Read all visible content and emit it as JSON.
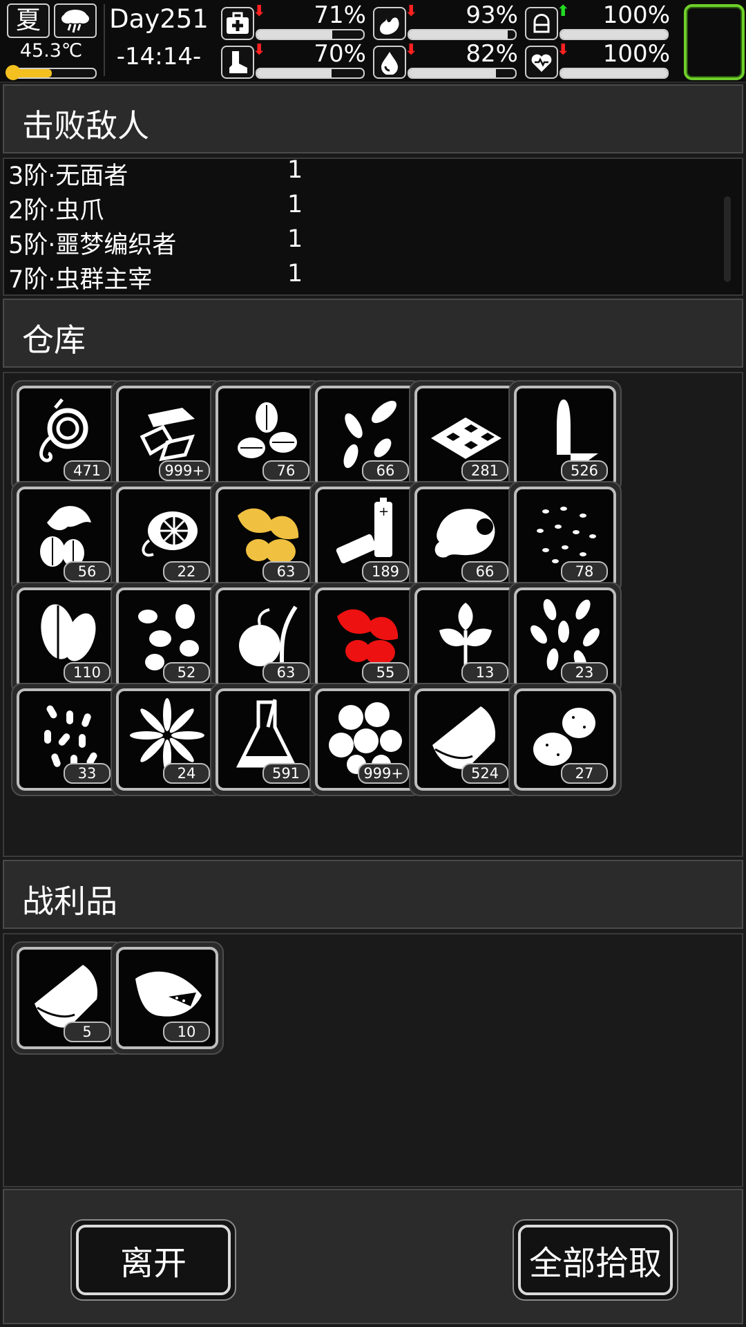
{
  "status": {
    "season": "夏",
    "weather_icon": "rain-cloud-icon",
    "temperature": "45.3℃",
    "temperature_level": 0.5,
    "day": "Day251",
    "time": "-14:14-",
    "stats": [
      {
        "id": "health",
        "icon": "medkit-icon",
        "value": "71%",
        "level": 0.71,
        "trend": "down"
      },
      {
        "id": "hunger",
        "icon": "stomach-icon",
        "value": "93%",
        "level": 0.93,
        "trend": "down"
      },
      {
        "id": "armor",
        "icon": "helmet-icon",
        "value": "100%",
        "level": 1.0,
        "trend": "up"
      },
      {
        "id": "stamina",
        "icon": "boot-icon",
        "value": "70%",
        "level": 0.7,
        "trend": "down"
      },
      {
        "id": "thirst",
        "icon": "water-drop-icon",
        "value": "82%",
        "level": 0.82,
        "trend": "down"
      },
      {
        "id": "mood",
        "icon": "heart-icon",
        "value": "100%",
        "level": 1.0,
        "trend": "down"
      }
    ],
    "accent_color": "#6fcf2a"
  },
  "enemies": {
    "title": "击败敌人",
    "rows": [
      {
        "name": "3阶·无面者",
        "count": "1"
      },
      {
        "name": "2阶·虫爪",
        "count": "1"
      },
      {
        "name": "5阶·噩梦编织者",
        "count": "1"
      },
      {
        "name": "7阶·虫群主宰",
        "count": "1"
      }
    ]
  },
  "storage": {
    "title": "仓库",
    "items": [
      {
        "icon": "rope-icon",
        "count": "471"
      },
      {
        "icon": "scrap-sheets-icon",
        "count": "999+"
      },
      {
        "icon": "seeds-icon",
        "count": "76"
      },
      {
        "icon": "sunflower-seeds-icon",
        "count": "66"
      },
      {
        "icon": "tray-food-icon",
        "count": "281"
      },
      {
        "icon": "nails-icon",
        "count": "526"
      },
      {
        "icon": "herb-seeds-icon",
        "count": "56"
      },
      {
        "icon": "citrus-icon",
        "count": "22"
      },
      {
        "icon": "yellow-herb-icon",
        "count": "63"
      },
      {
        "icon": "battery-icon",
        "count": "189"
      },
      {
        "icon": "meat-icon",
        "count": "66"
      },
      {
        "icon": "small-seeds-icon",
        "count": "78"
      },
      {
        "icon": "leaves-icon",
        "count": "110"
      },
      {
        "icon": "beans-icon",
        "count": "52"
      },
      {
        "icon": "sprout-fruit-icon",
        "count": "63"
      },
      {
        "icon": "red-herb-icon",
        "count": "55"
      },
      {
        "icon": "mint-icon",
        "count": "13"
      },
      {
        "icon": "grain-seeds-icon",
        "count": "23"
      },
      {
        "icon": "rice-icon",
        "count": "33"
      },
      {
        "icon": "flower-icon",
        "count": "24"
      },
      {
        "icon": "flask-icon",
        "count": "591"
      },
      {
        "icon": "cotton-icon",
        "count": "999+"
      },
      {
        "icon": "cloth-icon",
        "count": "524"
      },
      {
        "icon": "potato-icon",
        "count": "27"
      }
    ]
  },
  "loot": {
    "title": "战利品",
    "items": [
      {
        "icon": "cloth-icon",
        "count": "5"
      },
      {
        "icon": "ration-bag-icon",
        "count": "10"
      }
    ]
  },
  "buttons": {
    "leave": "离开",
    "take_all": "全部拾取"
  }
}
